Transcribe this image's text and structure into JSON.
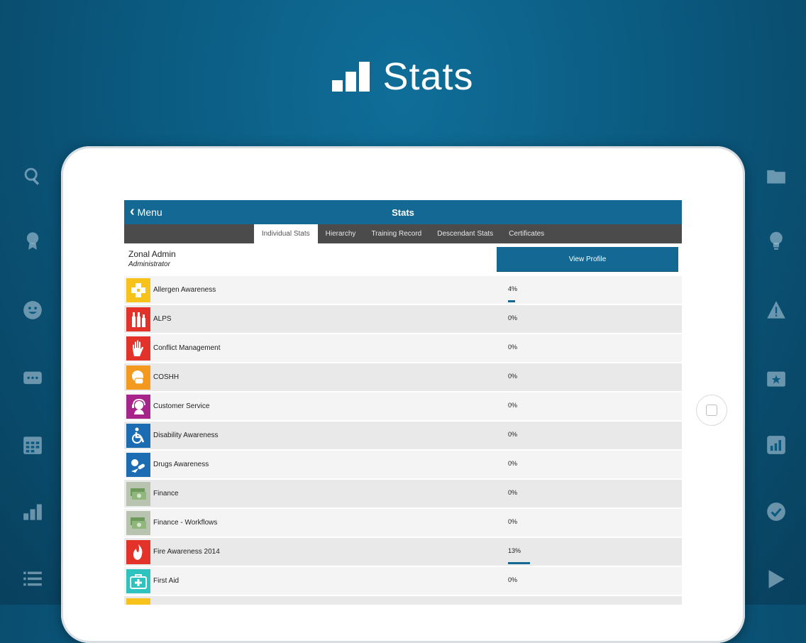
{
  "hero": {
    "title": "Stats",
    "icon": "bar-chart-icon"
  },
  "left_icons": [
    "search-icon",
    "award-icon",
    "smiley-icon",
    "chat-icon",
    "calendar-icon",
    "bar-chart-icon",
    "list-icon"
  ],
  "right_icons": [
    "folder-icon",
    "lightbulb-icon",
    "warning-icon",
    "star-card-icon",
    "stats-card-icon",
    "check-circle-icon",
    "play-icon"
  ],
  "navbar": {
    "back_label": "Menu",
    "title": "Stats"
  },
  "tabs": [
    {
      "label": "Individual Stats",
      "active": true
    },
    {
      "label": "Hierarchy",
      "active": false
    },
    {
      "label": "Training Record",
      "active": false
    },
    {
      "label": "Descendant Stats",
      "active": false
    },
    {
      "label": "Certificates",
      "active": false
    }
  ],
  "profile": {
    "name": "Zonal Admin",
    "role": "Administrator",
    "view_button": "View Profile"
  },
  "courses": [
    {
      "name": "Allergen Awareness",
      "percent": "4%",
      "progress": 4,
      "icon": "allergen-icon",
      "color": "#f7c21a"
    },
    {
      "name": "ALPS",
      "percent": "0%",
      "progress": 0,
      "icon": "bottles-icon",
      "color": "#e2322a"
    },
    {
      "name": "Conflict Management",
      "percent": "0%",
      "progress": 0,
      "icon": "hand-stop-icon",
      "color": "#e2322a"
    },
    {
      "name": "COSHH",
      "percent": "0%",
      "progress": 0,
      "icon": "respirator-icon",
      "color": "#f39a1e"
    },
    {
      "name": "Customer Service",
      "percent": "0%",
      "progress": 0,
      "icon": "headset-icon",
      "color": "#a7248b"
    },
    {
      "name": "Disability Awareness",
      "percent": "0%",
      "progress": 0,
      "icon": "wheelchair-icon",
      "color": "#1b6cb3"
    },
    {
      "name": "Drugs Awareness",
      "percent": "0%",
      "progress": 0,
      "icon": "pills-icon",
      "color": "#1b6cb3"
    },
    {
      "name": "Finance",
      "percent": "0%",
      "progress": 0,
      "icon": "money-icon",
      "color": "#b9c4b0"
    },
    {
      "name": "Finance - Workflows",
      "percent": "0%",
      "progress": 0,
      "icon": "money-icon",
      "color": "#b9c4b0"
    },
    {
      "name": "Fire Awareness 2014",
      "percent": "13%",
      "progress": 13,
      "icon": "flame-icon",
      "color": "#e2322a"
    },
    {
      "name": "First Aid",
      "percent": "0%",
      "progress": 0,
      "icon": "first-aid-icon",
      "color": "#2fc3bf"
    },
    {
      "name": "",
      "percent": "",
      "progress": 0,
      "icon": "partial-icon",
      "color": "#f7c21a"
    }
  ]
}
